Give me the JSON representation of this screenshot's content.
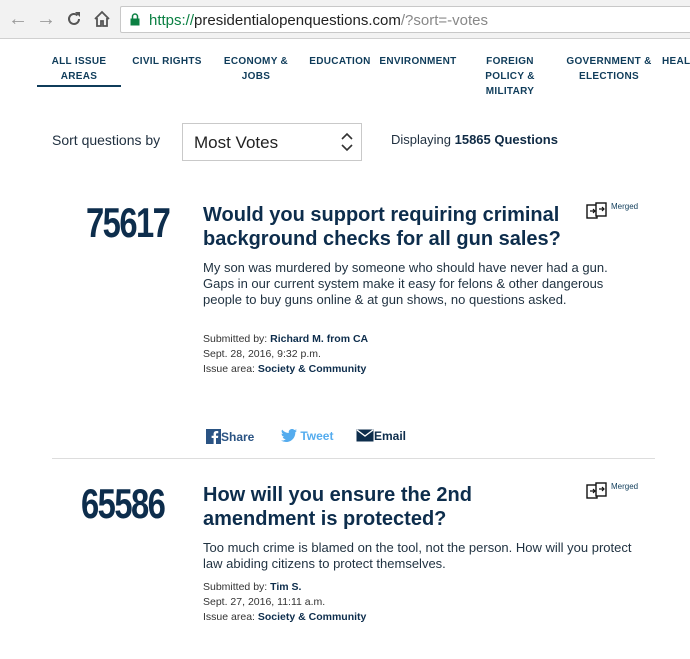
{
  "browser": {
    "url_https": "https://",
    "url_domain": "presidentialopenquestions.com",
    "url_rest": "/?sort=-votes"
  },
  "nav": {
    "items": [
      {
        "label": "ALL ISSUE AREAS"
      },
      {
        "label": "CIVIL RIGHTS"
      },
      {
        "label": "ECONOMY & JOBS"
      },
      {
        "label": "EDUCATION"
      },
      {
        "label": "ENVIRONMENT"
      },
      {
        "label": "FOREIGN POLICY & MILITARY"
      },
      {
        "label": "GOVERNMENT & ELECTIONS"
      },
      {
        "label": "HEAL"
      }
    ]
  },
  "sort": {
    "label": "Sort questions by",
    "selected": "Most Votes",
    "displaying_prefix": "Displaying",
    "displaying_count": "15865 Questions"
  },
  "questions": [
    {
      "votes": "75617",
      "title": "Would you support requiring criminal background checks for all gun sales?",
      "body": "My son was murdered by someone who should have never had a gun. Gaps in our current system make it easy for felons & other dangerous people to buy guns online & at gun shows, no questions asked.",
      "submitted_label": "Submitted by:",
      "submitted_by": "Richard M. from CA",
      "date": "Sept. 28, 2016, 9:32 p.m.",
      "issue_label": "Issue area:",
      "issue_area": "Society & Community",
      "merged": "Merged"
    },
    {
      "votes": "65586",
      "title": "How will you ensure the 2nd amendment is protected?",
      "body": "Too much crime is blamed on the tool, not the person. How will you protect law abiding citizens to protect themselves.",
      "submitted_label": "Submitted by:",
      "submitted_by": "Tim S.",
      "date": "Sept. 27, 2016, 11:11 a.m.",
      "issue_label": "Issue area:",
      "issue_area": "Society & Community",
      "merged": "Merged"
    }
  ],
  "share": {
    "facebook": "Share",
    "twitter": "Tweet",
    "email": "Email"
  }
}
